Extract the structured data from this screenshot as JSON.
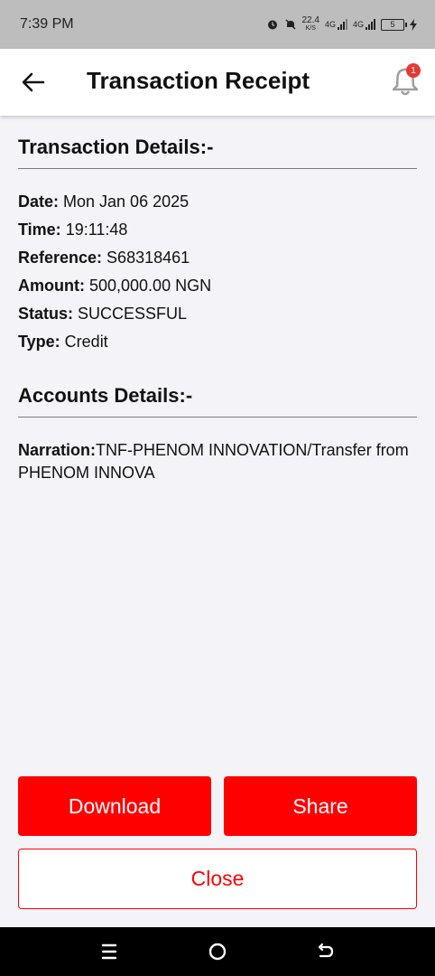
{
  "status_bar": {
    "time": "7:39 PM",
    "net_speed_value": "22.4",
    "net_speed_unit": "K/S",
    "network_1": "4G",
    "network_2": "4G",
    "battery": "5"
  },
  "app_bar": {
    "title": "Transaction Receipt",
    "notification_count": "1"
  },
  "transaction_details": {
    "heading": "Transaction Details:-",
    "rows": [
      {
        "label": "Date:",
        "value": " Mon Jan 06 2025"
      },
      {
        "label": "Time:",
        "value": " 19:11:48"
      },
      {
        "label": "Reference:",
        "value": " S68318461"
      },
      {
        "label": "Amount:",
        "value": " 500,000.00 NGN"
      },
      {
        "label": "Status:",
        "value": " SUCCESSFUL"
      },
      {
        "label": "Type:",
        "value": " Credit"
      }
    ]
  },
  "account_details": {
    "heading": "Accounts Details:-",
    "narration_label": "Narration:",
    "narration_value": "TNF-PHENOM INNOVATION/Transfer from  PHENOM INNOVA"
  },
  "actions": {
    "download_label": "Download",
    "share_label": "Share",
    "close_label": "Close"
  },
  "colors": {
    "accent": "#ff0000",
    "badge": "#e53935",
    "background": "#f4f4f8",
    "status_bar": "#bdbdbd"
  },
  "icons": [
    "back-arrow-icon",
    "bell-icon",
    "alarm-icon",
    "mute-icon",
    "signal-icon",
    "battery-icon",
    "charging-icon",
    "menu-icon",
    "home-icon",
    "back-nav-icon"
  ]
}
